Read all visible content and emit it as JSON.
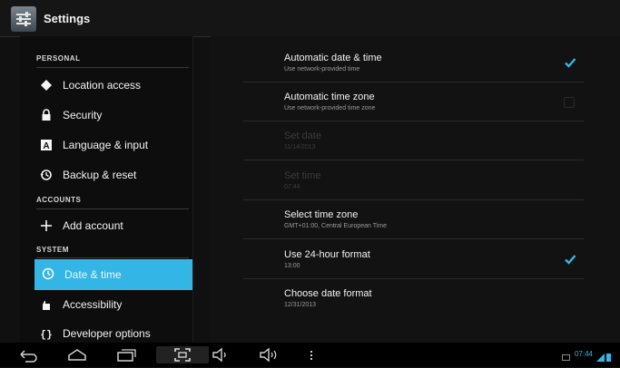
{
  "app": {
    "title": "Settings"
  },
  "sidebar": {
    "sections": [
      {
        "header": "PERSONAL"
      },
      {
        "header": "ACCOUNTS"
      },
      {
        "header": "SYSTEM"
      }
    ],
    "items": [
      {
        "label": "Location access",
        "icon": "location-icon"
      },
      {
        "label": "Security",
        "icon": "lock-icon"
      },
      {
        "label": "Language & input",
        "icon": "keyboard-icon"
      },
      {
        "label": "Backup & reset",
        "icon": "backup-icon"
      },
      {
        "label": "Add account",
        "icon": "plus-icon"
      },
      {
        "label": "Date & time",
        "icon": "clock-icon",
        "selected": true
      },
      {
        "label": "Accessibility",
        "icon": "hand-icon"
      },
      {
        "label": "Developer options",
        "icon": "braces-icon"
      }
    ]
  },
  "prefs": [
    {
      "title": "Automatic date & time",
      "summary": "Use network-provided time",
      "checked": true,
      "enabled": true
    },
    {
      "title": "Automatic time zone",
      "summary": "Use network-provided time zone",
      "checked": false,
      "enabled": true
    },
    {
      "title": "Set date",
      "summary": "11/14/2013",
      "enabled": false
    },
    {
      "title": "Set time",
      "summary": "07:44",
      "enabled": false
    },
    {
      "title": "Select time zone",
      "summary": "GMT+01:00, Central European Time",
      "enabled": true
    },
    {
      "title": "Use 24-hour format",
      "summary": "13:00",
      "checked": true,
      "enabled": true
    },
    {
      "title": "Choose date format",
      "summary": "12/31/2013",
      "enabled": true
    }
  ],
  "navbar": {
    "buttons": [
      "back-icon",
      "home-icon",
      "recents-icon",
      "screenshot-icon",
      "volume-down-icon",
      "volume-up-icon",
      "menu-icon"
    ],
    "clock": "07:44"
  },
  "colors": {
    "accent": "#33b5e5",
    "background": "#101010"
  }
}
